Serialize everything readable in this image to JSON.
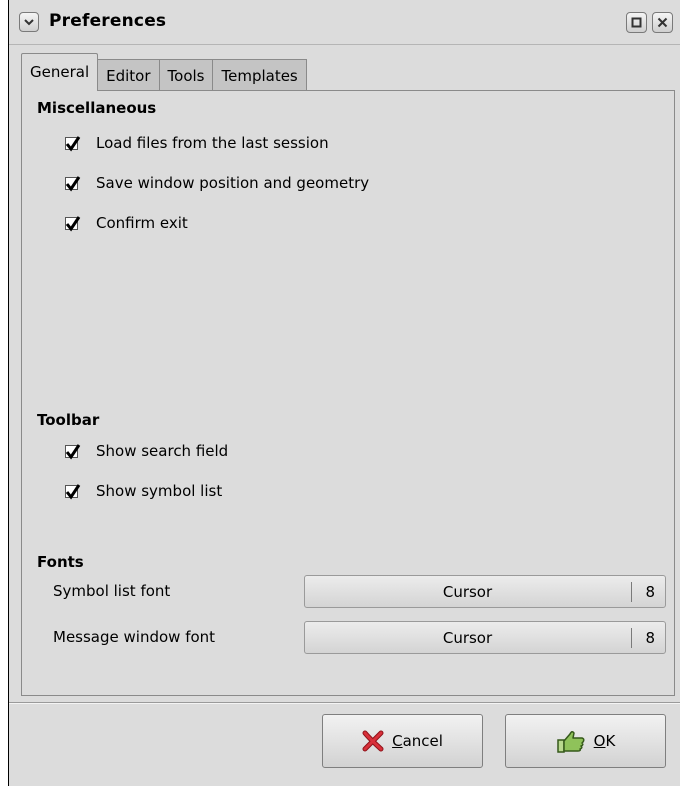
{
  "window": {
    "title": "Preferences",
    "menu_icon": "chevron-down-icon",
    "maximize_icon": "maximize-icon",
    "close_icon": "close-icon"
  },
  "tabs": [
    {
      "label": "General",
      "active": true
    },
    {
      "label": "Editor",
      "active": false
    },
    {
      "label": "Tools",
      "active": false
    },
    {
      "label": "Templates",
      "active": false
    }
  ],
  "miscellaneous": {
    "heading": "Miscellaneous",
    "options": [
      {
        "label": "Load files from the last session",
        "checked": true
      },
      {
        "label": "Save window position and geometry",
        "checked": true
      },
      {
        "label": "Confirm exit",
        "checked": true
      }
    ]
  },
  "toolbar": {
    "heading": "Toolbar",
    "options": [
      {
        "label": "Show search field",
        "checked": true
      },
      {
        "label": "Show symbol list",
        "checked": true
      }
    ]
  },
  "fonts": {
    "heading": "Fonts",
    "rows": [
      {
        "label": "Symbol list font",
        "font": "Cursor",
        "size": "8"
      },
      {
        "label": "Message window font",
        "font": "Cursor",
        "size": "8"
      }
    ]
  },
  "buttons": {
    "cancel": {
      "mnemonic": "C",
      "rest": "ancel",
      "icon": "cancel-x-icon"
    },
    "ok": {
      "mnemonic": "O",
      "rest": "K",
      "icon": "ok-hand-icon"
    }
  },
  "colors": {
    "background": "#dcdcdc",
    "tab_inactive": "#c4c4c4",
    "cancel_icon": "#c8202b",
    "ok_icon": "#6da33a"
  }
}
